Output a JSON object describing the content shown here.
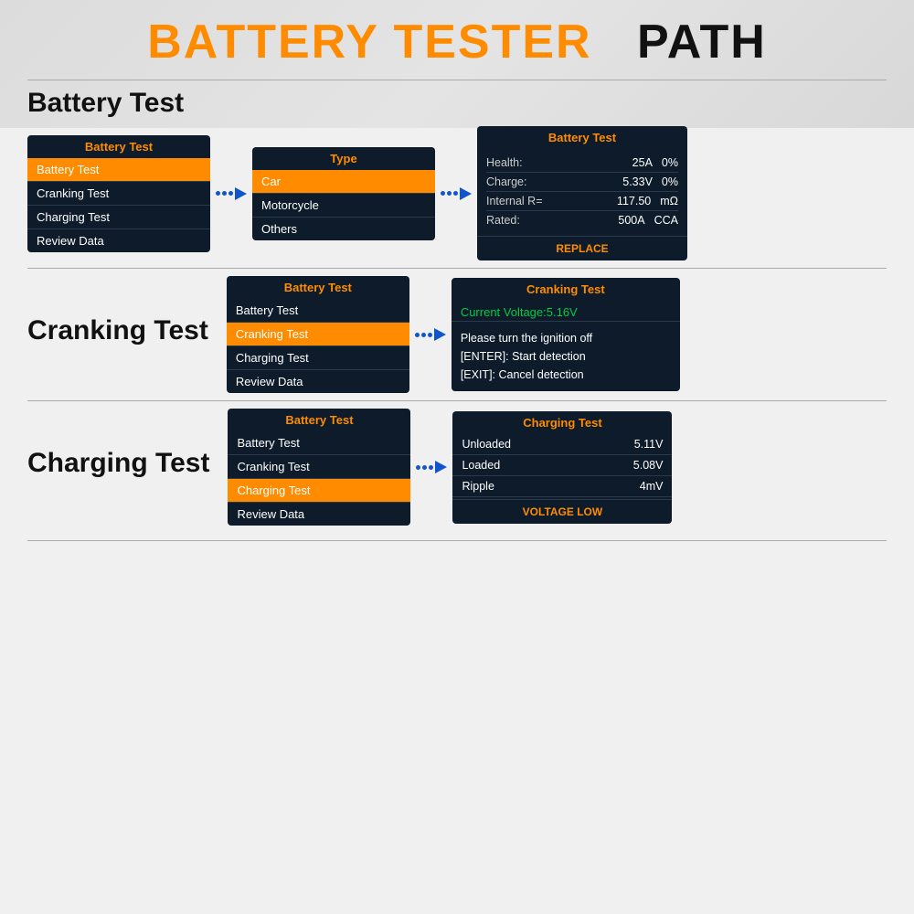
{
  "header": {
    "title_orange": "BATTERY TESTER",
    "title_black": "PATH"
  },
  "battery_test_section": {
    "title": "Battery Test",
    "menu_screen": {
      "header": "Battery Test",
      "items": [
        {
          "label": "Battery Test",
          "selected": true
        },
        {
          "label": "Cranking Test",
          "selected": false
        },
        {
          "label": "Charging Test",
          "selected": false
        },
        {
          "label": "Review Data",
          "selected": false
        }
      ]
    },
    "type_screen": {
      "header": "Type",
      "items": [
        {
          "label": "Car",
          "selected": true
        },
        {
          "label": "Motorcycle",
          "selected": false
        },
        {
          "label": "Others",
          "selected": false
        }
      ]
    },
    "result_screen": {
      "header": "Battery Test",
      "rows": [
        {
          "label": "Health:",
          "val1": "25A",
          "val2": "0%"
        },
        {
          "label": "Charge:",
          "val1": "5.33V",
          "val2": "0%"
        },
        {
          "label": "Internal R=",
          "val1": "117.50",
          "val2": "mΩ"
        },
        {
          "label": "Rated:",
          "val1": "500A",
          "val2": "CCA"
        }
      ],
      "footer": "REPLACE"
    }
  },
  "cranking_test_section": {
    "title": "Cranking Test",
    "menu_screen": {
      "header": "Battery Test",
      "items": [
        {
          "label": "Battery Test",
          "selected": false
        },
        {
          "label": "Cranking Test",
          "selected": true
        },
        {
          "label": "Charging Test",
          "selected": false
        },
        {
          "label": "Review Data",
          "selected": false
        }
      ]
    },
    "result_screen": {
      "header": "Cranking Test",
      "voltage": "Current Voltage:5.16V",
      "instructions": "Please turn the ignition off\n[ENTER]: Start detection\n[EXIT]: Cancel detection"
    }
  },
  "charging_test_section": {
    "title": "Charging Test",
    "menu_screen": {
      "header": "Battery Test",
      "items": [
        {
          "label": "Battery Test",
          "selected": false
        },
        {
          "label": "Cranking Test",
          "selected": false
        },
        {
          "label": "Charging Test",
          "selected": true
        },
        {
          "label": "Review Data",
          "selected": false
        }
      ]
    },
    "result_screen": {
      "header": "Charging Test",
      "rows": [
        {
          "label": "Unloaded",
          "value": "5.11V"
        },
        {
          "label": "Loaded",
          "value": "5.08V"
        },
        {
          "label": "Ripple",
          "value": "4mV"
        }
      ],
      "footer": "VOLTAGE LOW"
    }
  }
}
